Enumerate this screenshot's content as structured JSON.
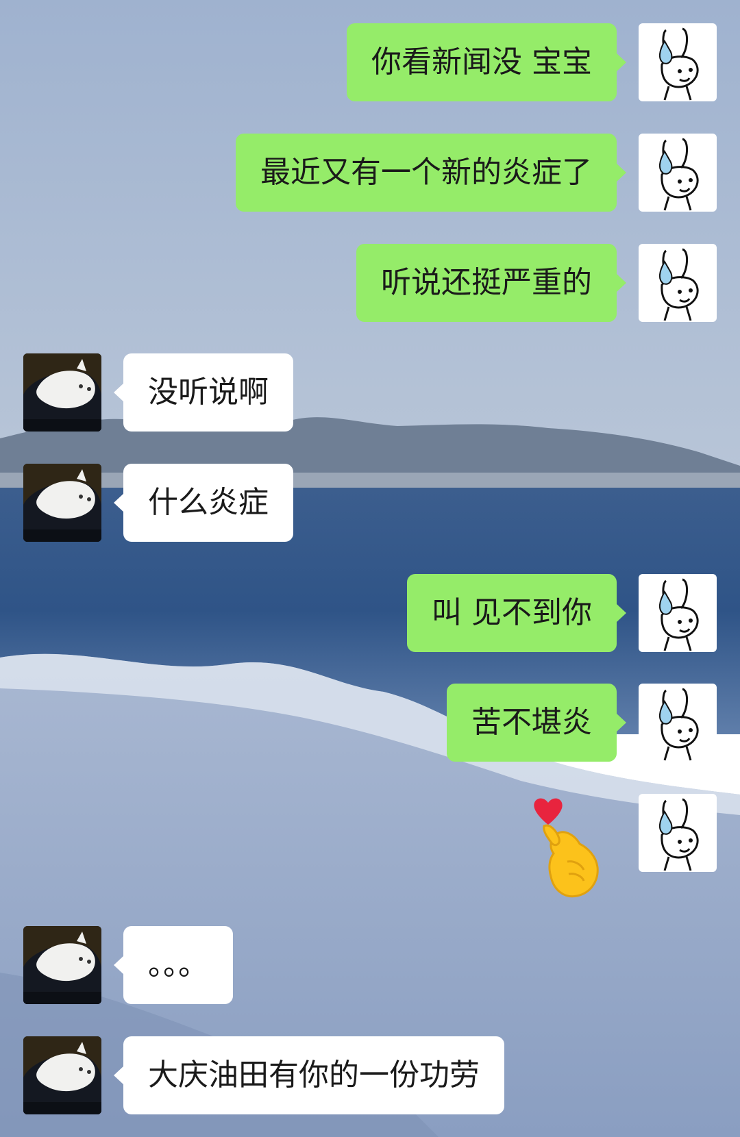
{
  "chat": {
    "messages": [
      {
        "sender": "me",
        "text": "你看新闻没 宝宝"
      },
      {
        "sender": "me",
        "text": "最近又有一个新的炎症了"
      },
      {
        "sender": "me",
        "text": "听说还挺严重的"
      },
      {
        "sender": "other",
        "text": "没听说啊"
      },
      {
        "sender": "other",
        "text": "什么炎症"
      },
      {
        "sender": "me",
        "text": "叫 见不到你"
      },
      {
        "sender": "me",
        "text": "苦不堪炎"
      },
      {
        "sender": "me",
        "sticker": "finger-heart-emoji"
      },
      {
        "sender": "other",
        "text": "。。。"
      },
      {
        "sender": "other",
        "text": "大庆油田有你的一份功劳"
      }
    ],
    "avatars": {
      "me": "rabbit-sweat-drop-icon",
      "other": "white-cat-photo"
    }
  },
  "colors": {
    "my_bubble": "#95ec69",
    "their_bubble": "#ffffff",
    "text": "#1a1a1a"
  }
}
